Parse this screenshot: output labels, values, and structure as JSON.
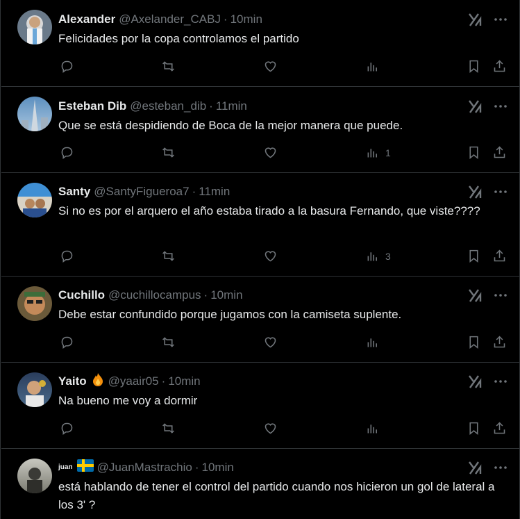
{
  "colors": {
    "background": "#000000",
    "text": "#e7e9ea",
    "muted": "#71767b",
    "divider": "#2f3336"
  },
  "icons": {
    "grok": "grok-icon",
    "more": "more-icon",
    "reply": "reply-icon",
    "retweet": "retweet-icon",
    "like": "like-icon",
    "views": "views-icon",
    "bookmark": "bookmark-icon",
    "share": "share-icon"
  },
  "tweets": [
    {
      "name": "Alexander",
      "handle": "@Axelander_CABJ",
      "time": "10min",
      "text": "Felicidades por la copa controlamos el partido",
      "views": ""
    },
    {
      "name": "Esteban Dib",
      "handle": "@esteban_dib",
      "time": "11min",
      "text": "Que se está despidiendo de Boca de la mejor manera que puede.",
      "views": "1"
    },
    {
      "name": "Santy",
      "handle": "@SantyFigueroa7",
      "time": "11min",
      "text": "Si no es por el arquero el año estaba  tirado a la basura Fernando, que viste????",
      "views": "3"
    },
    {
      "name": "Cuchillo",
      "handle": "@cuchillocampus",
      "time": "10min",
      "text": "Debe estar confundido porque jugamos con la camiseta suplente.",
      "views": ""
    },
    {
      "name": "Yaito",
      "handle": "@yaair05",
      "time": "10min",
      "text": "Na bueno me voy a dormir",
      "views": ""
    },
    {
      "name": "juan",
      "handle": "@JuanMastrachio",
      "time": "10min",
      "text": "está hablando de tener el control del partido cuando nos hicieron un gol de lateral a los 3' ?",
      "views": ""
    }
  ]
}
